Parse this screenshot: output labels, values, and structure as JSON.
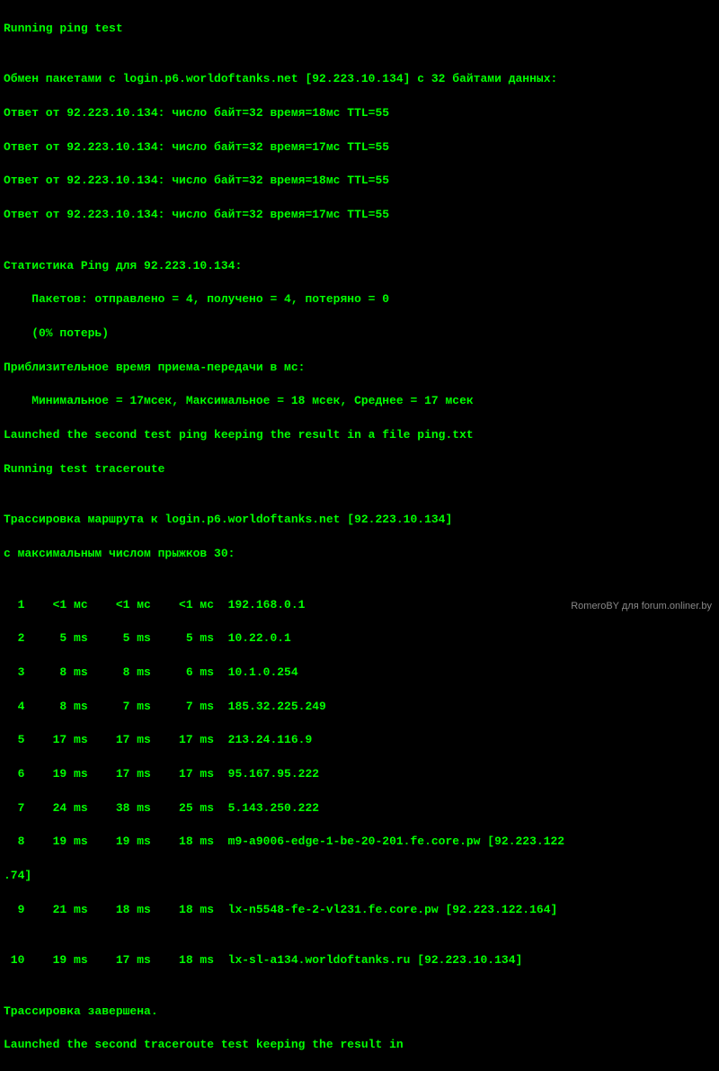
{
  "terminal": {
    "header": "Running ping test",
    "blank1": "",
    "exchange": "Обмен пакетами с login.p6.worldoftanks.net [92.223.10.134] с 32 байтами данных:",
    "replies": [
      "Ответ от 92.223.10.134: число байт=32 время=18мс TTL=55",
      "Ответ от 92.223.10.134: число байт=32 время=17мс TTL=55",
      "Ответ от 92.223.10.134: число байт=32 время=18мс TTL=55",
      "Ответ от 92.223.10.134: число байт=32 время=17мс TTL=55"
    ],
    "blank2": "",
    "stats_header": "Статистика Ping для 92.223.10.134:",
    "stats_packets": "    Пакетов: отправлено = 4, получено = 4, потеряно = 0",
    "stats_loss": "    (0% потерь)",
    "approx_header": "Приблизительное время приема-передачи в мс:",
    "approx_values": "    Минимальное = 17мсек, Максимальное = 18 мсек, Среднее = 17 мсек",
    "launched_ping": "Launched the second test ping keeping the result in a file ping.txt",
    "traceroute_header": "Running test traceroute",
    "blank3": "",
    "trace_target": "Трассировка маршрута к login.p6.worldoftanks.net [92.223.10.134]",
    "trace_hops_max": "с максимальным числом прыжков 30:",
    "blank4": "",
    "hops": [
      "  1    <1 мс    <1 мс    <1 мс  192.168.0.1",
      "  2     5 ms     5 ms     5 ms  10.22.0.1",
      "  3     8 ms     8 ms     6 ms  10.1.0.254",
      "  4     8 ms     7 ms     7 ms  185.32.225.249",
      "  5    17 ms    17 ms    17 ms  213.24.116.9",
      "  6    19 ms    17 ms    17 ms  95.167.95.222",
      "  7    24 ms    38 ms    25 ms  5.143.250.222",
      "  8    19 ms    19 ms    18 ms  m9-a9006-edge-1-be-20-201.fe.core.pw [92.223.122",
      ".74]",
      "  9    21 ms    18 ms    18 ms  lx-n5548-fe-2-vl231.fe.core.pw [92.223.122.164]",
      "",
      " 10    19 ms    17 ms    18 ms  lx-sl-a134.worldoftanks.ru [92.223.10.134]"
    ],
    "blank5": "",
    "trace_done": "Трассировка завершена.",
    "launched_trace": "Launched the second traceroute test keeping the result in"
  },
  "watermark": "RomeroBY для forum.onliner.by"
}
